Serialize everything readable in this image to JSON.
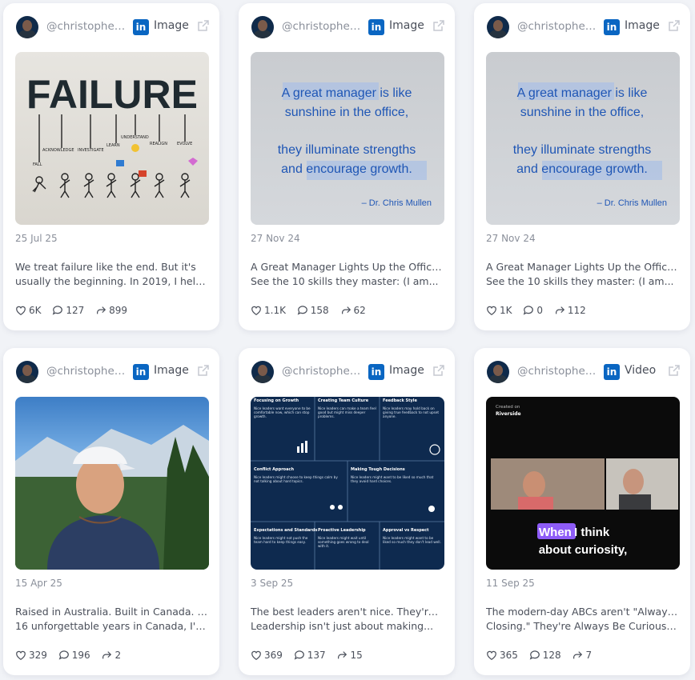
{
  "cards": [
    {
      "handle": "@christopherr...",
      "type": "Image",
      "date": "25 Jul 25",
      "text_line1": "We treat failure like the end. But it's",
      "text_line2": "usually the beginning. In 2019, I helped...",
      "likes": "6K",
      "comments": "127",
      "reposts": "899",
      "media": {
        "title": "FAILURE",
        "labels": [
          "FALL",
          "ACKNOWLEDGE",
          "INVESTIGATE",
          "LEARN",
          "UNDERSTAND",
          "REALIGN",
          "EVOLVE"
        ]
      }
    },
    {
      "handle": "@christopherr...",
      "type": "Image",
      "date": "27 Nov 24",
      "text_line1": "A Great Manager Lights Up the Office 💡",
      "text_line2": "See the 10 skills they master: (I am...",
      "likes": "1.1K",
      "comments": "158",
      "reposts": "62",
      "media": {
        "quote1": "A great manager is like",
        "quote2": "sunshine in the office,",
        "quote3": "they illuminate strengths",
        "quote4": "and encourage growth.",
        "author": "– Dr. Chris Mullen"
      }
    },
    {
      "handle": "@christopherr...",
      "type": "Image",
      "date": "27 Nov 24",
      "text_line1": "A Great Manager Lights Up the Office 💡",
      "text_line2": "See the 10 skills they master: (I am...",
      "likes": "1K",
      "comments": "0",
      "reposts": "112",
      "media": {
        "quote1": "A great manager is like",
        "quote2": "sunshine in the office,",
        "quote3": "they illuminate strengths",
        "quote4": "and encourage growth.",
        "author": "– Dr. Chris Mullen"
      }
    },
    {
      "handle": "@christopherr...",
      "type": "Image",
      "date": "15 Apr 25",
      "text_line1": "Raised in Australia. Built in Canada. After",
      "text_line2": "16 unforgettable years in Canada, I've...",
      "likes": "329",
      "comments": "196",
      "reposts": "2"
    },
    {
      "handle": "@christopherr...",
      "type": "Image",
      "date": "3 Sep 25",
      "text_line1": "The best leaders aren't nice. They're kind.",
      "text_line2": "Leadership isn't just about making...",
      "likes": "369",
      "comments": "137",
      "reposts": "15",
      "media": {
        "cells": [
          {
            "title": "Focusing on Growth",
            "body": "Nice leaders want everyone to be comfortable now, which can stop growth."
          },
          {
            "title": "Creating Team Culture",
            "body": "Nice leaders can make a team feel good but might miss deeper problems."
          },
          {
            "title": "Feedback Style",
            "body": "Nice leaders may hold back on giving true feedback to not upset anyone."
          },
          {
            "title": "Conflict Approach",
            "body": "Nice leaders might choose to keep things calm by not talking about hard topics."
          },
          {
            "title": "Making Tough Decisions",
            "body": "Nice leaders might want to be liked so much that they avoid hard choices."
          },
          {
            "title": "Expectations and Standards",
            "body": "Nice leaders might not push the team hard to keep things easy."
          },
          {
            "title": "Proactive Leadership",
            "body": "Nice leaders might wait until something goes wrong to deal with it."
          },
          {
            "title": "Approval vs Respect",
            "body": "Nice leaders might want to be liked so much they don't lead well."
          }
        ]
      }
    },
    {
      "handle": "@christopherr...",
      "type": "Video",
      "date": "11 Sep 25",
      "text_line1": "The modern-day ABCs aren't \"Always Be",
      "text_line2": "Closing.\" They're Always Be Curious. The...",
      "likes": "365",
      "comments": "128",
      "reposts": "7",
      "media": {
        "created_on": "Created on",
        "brand": "Riverside",
        "caption_highlight": "When",
        "caption_rest": " I think",
        "caption_line2": "about curiosity,"
      }
    }
  ],
  "colors": {
    "linkedin": "#0a66c2",
    "quote_text": "#1f56b5"
  }
}
